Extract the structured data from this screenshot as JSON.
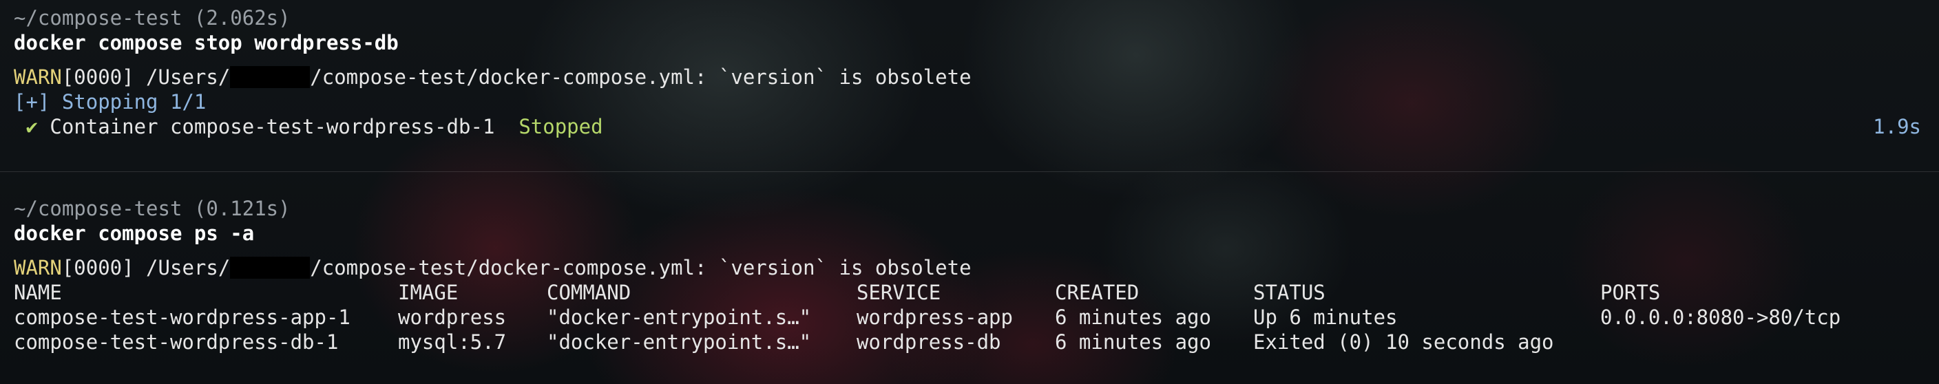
{
  "block1": {
    "prompt": "~/compose-test (2.062s)",
    "command": "docker compose stop wordpress-db",
    "warn_tag": "WARN",
    "warn_code": "[0000] /Users/",
    "warn_rest": "/compose-test/docker-compose.yml: `version` is obsolete",
    "stopping": "[+] Stopping 1/1",
    "check": "✔",
    "container_text": " Container compose-test-wordpress-db-1  ",
    "stopped": "Stopped",
    "duration": "1.9s"
  },
  "block2": {
    "prompt": "~/compose-test (0.121s)",
    "command": "docker compose ps -a",
    "warn_tag": "WARN",
    "warn_code": "[0000] /Users/",
    "warn_rest": "/compose-test/docker-compose.yml: `version` is obsolete",
    "headers": {
      "name": "NAME",
      "image": "IMAGE",
      "command": "COMMAND",
      "service": "SERVICE",
      "created": "CREATED",
      "status": "STATUS",
      "ports": "PORTS"
    },
    "rows": [
      {
        "name": "compose-test-wordpress-app-1",
        "image": "wordpress",
        "command": "\"docker-entrypoint.s…\"",
        "service": "wordpress-app",
        "created": "6 minutes ago",
        "status": "Up 6 minutes",
        "ports": "0.0.0.0:8080->80/tcp"
      },
      {
        "name": "compose-test-wordpress-db-1",
        "image": "mysql:5.7",
        "command": "\"docker-entrypoint.s…\"",
        "service": "wordpress-db",
        "created": "6 minutes ago",
        "status": "Exited (0) 10 seconds ago",
        "ports": ""
      }
    ]
  },
  "colors": {
    "warn": "#e4d27a",
    "stopping": "#8fb6e0",
    "success": "#b6d86a",
    "prompt": "#9aa0a6"
  }
}
